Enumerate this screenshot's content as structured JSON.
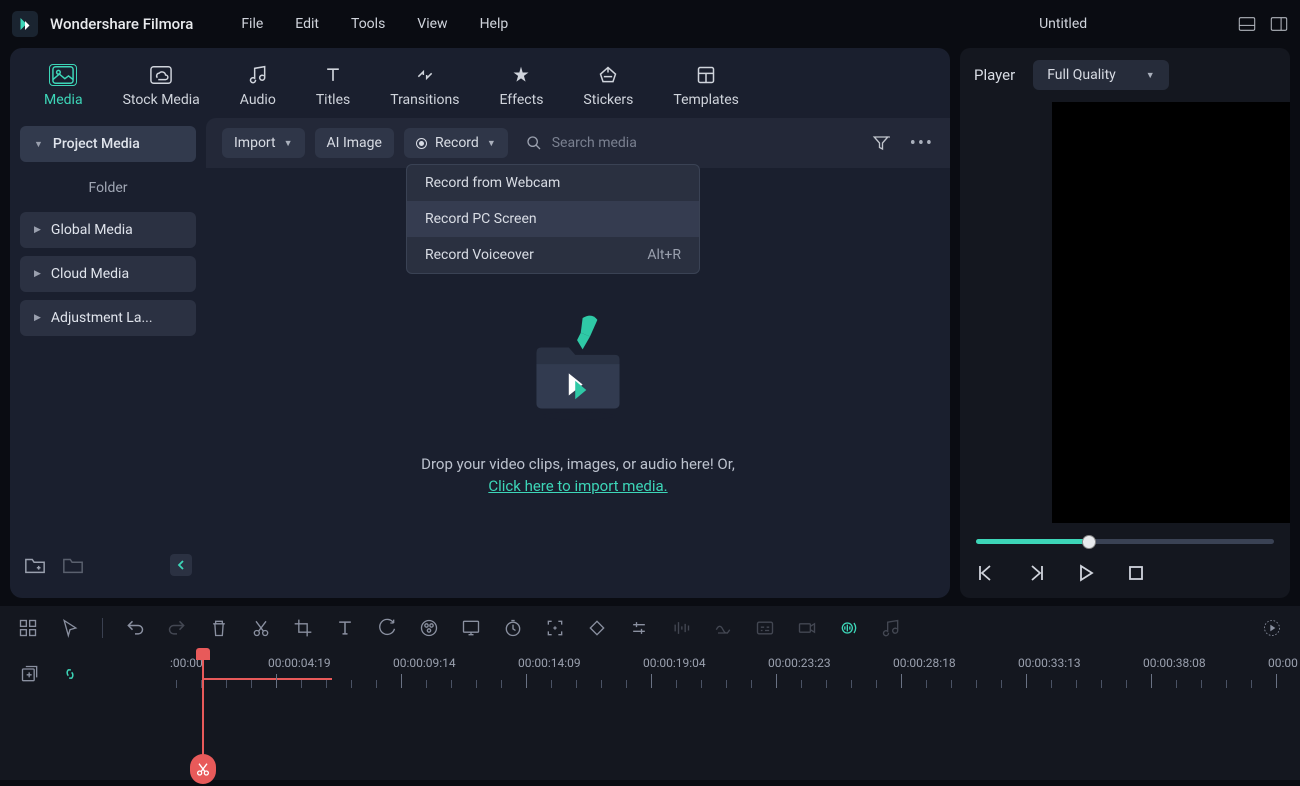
{
  "app": {
    "title": "Wondershare Filmora",
    "document": "Untitled"
  },
  "menu": [
    "File",
    "Edit",
    "Tools",
    "View",
    "Help"
  ],
  "categories": [
    {
      "label": "Media",
      "icon": "media",
      "active": true
    },
    {
      "label": "Stock Media",
      "icon": "cloud"
    },
    {
      "label": "Audio",
      "icon": "audio"
    },
    {
      "label": "Titles",
      "icon": "titles"
    },
    {
      "label": "Transitions",
      "icon": "transitions"
    },
    {
      "label": "Effects",
      "icon": "effects"
    },
    {
      "label": "Stickers",
      "icon": "stickers"
    },
    {
      "label": "Templates",
      "icon": "templates"
    }
  ],
  "sidebar": {
    "items": [
      {
        "label": "Project Media",
        "active": true
      },
      {
        "label": "Folder",
        "plain": true
      },
      {
        "label": "Global Media"
      },
      {
        "label": "Cloud Media"
      },
      {
        "label": "Adjustment La..."
      }
    ]
  },
  "toolbar": {
    "import": "Import",
    "ai_image": "AI Image",
    "record": "Record",
    "search_placeholder": "Search media"
  },
  "record_menu": [
    {
      "label": "Record from Webcam",
      "shortcut": ""
    },
    {
      "label": "Record PC Screen",
      "shortcut": "",
      "hover": true
    },
    {
      "label": "Record Voiceover",
      "shortcut": "Alt+R"
    }
  ],
  "dropzone": {
    "text": "Drop your video clips, images, or audio here! Or,",
    "link": "Click here to import media."
  },
  "player": {
    "label": "Player",
    "quality": "Full Quality"
  },
  "timeline": {
    "start": ":00:00",
    "labels": [
      "00:00:04:19",
      "00:00:09:14",
      "00:00:14:09",
      "00:00:19:04",
      "00:00:23:23",
      "00:00:28:18",
      "00:00:33:13",
      "00:00:38:08",
      "00:00"
    ]
  }
}
